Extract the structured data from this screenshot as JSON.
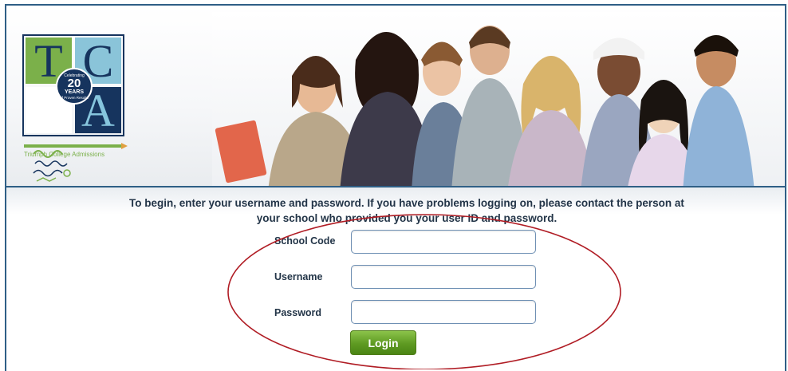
{
  "logo": {
    "letters": [
      "T",
      "C",
      "",
      "A"
    ],
    "badge": {
      "top": "Celebrating",
      "number": "20",
      "years": "YEARS",
      "bottom": "of Proven Results"
    },
    "tagline": "Triumph College Admissions"
  },
  "header": {
    "photo_description": "group of smiling high school students"
  },
  "instructions": "To begin, enter your username and password. If you have problems logging on, please contact the person at your school who provided you your user ID and password.",
  "form": {
    "school_code_label": "School Code",
    "school_code_value": "",
    "username_label": "Username",
    "username_value": "",
    "password_label": "Password",
    "password_value": "",
    "login_label": "Login"
  },
  "colors": {
    "border_blue": "#2f5f86",
    "logo_navy": "#16345e",
    "logo_green": "#7bb04a",
    "logo_lightblue": "#8ac4d9",
    "login_green": "#5e9a22",
    "annotation_red": "#b01c24",
    "label_text": "#233548"
  }
}
